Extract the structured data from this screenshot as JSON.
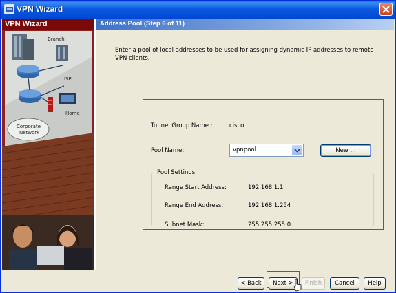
{
  "window": {
    "title": "VPN Wizard"
  },
  "sidebar": {
    "title": "VPN Wizard"
  },
  "header": {
    "title": "Address Pool  (Step 6 of 11)"
  },
  "instructions": "Enter a pool of local addresses to be used for assigning dynamic IP addresses to remote VPN clients.",
  "form": {
    "tunnel_group_label": "Tunnel Group Name :",
    "tunnel_group_value": "cisco",
    "pool_name_label": "Pool Name:",
    "pool_name_value": "vpnpool",
    "new_button": "New ...",
    "pool_settings_title": "Pool Settings",
    "range_start_label": "Range Start Address:",
    "range_start_value": "192.168.1.1",
    "range_end_label": "Range End Address:",
    "range_end_value": "192.168.1.254",
    "subnet_mask_label": "Subnet Mask:",
    "subnet_mask_value": "255.255.255.0"
  },
  "buttons": {
    "back": "< Back",
    "next": "Next >",
    "finish": "Finish",
    "cancel": "Cancel",
    "help": "Help"
  },
  "illustration_labels": {
    "branch": "Branch",
    "isp": "ISP",
    "home": "Home",
    "corporate": "Corporate",
    "network": "Network"
  },
  "colors": {
    "highlight_border": "#d42a2a",
    "title_bar": "#0a5ae0",
    "sidebar_header": "#7a0a0a"
  }
}
